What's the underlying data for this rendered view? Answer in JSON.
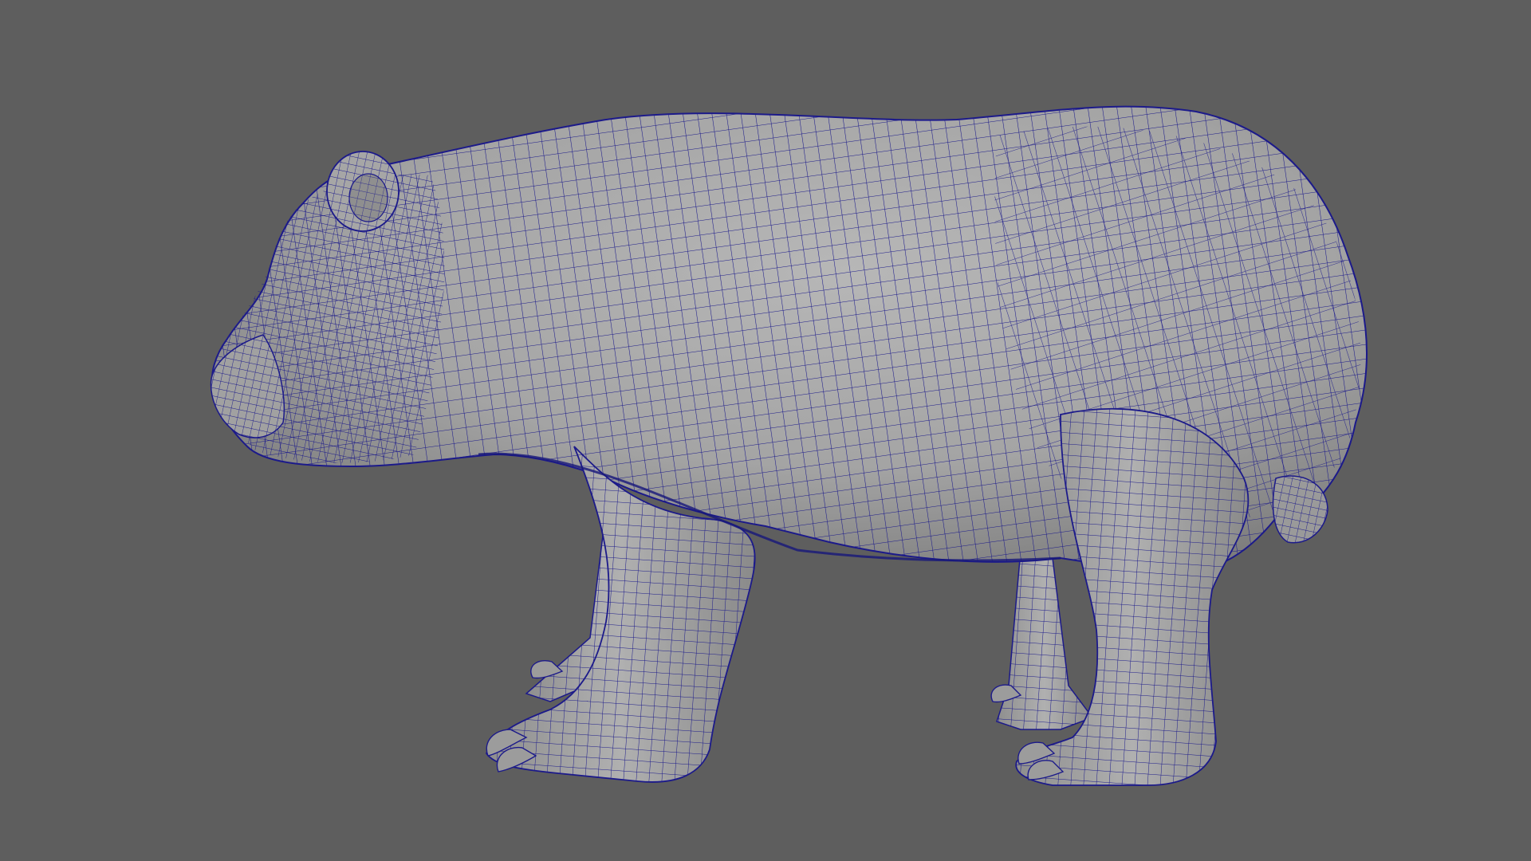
{
  "viewport": {
    "background_color": "#5e5e5e",
    "model": {
      "subject": "bear",
      "display_mode": "wireframe-on-shaded",
      "surface_color": "#a7a7a7",
      "wire_color": "#1c1a8a"
    }
  }
}
